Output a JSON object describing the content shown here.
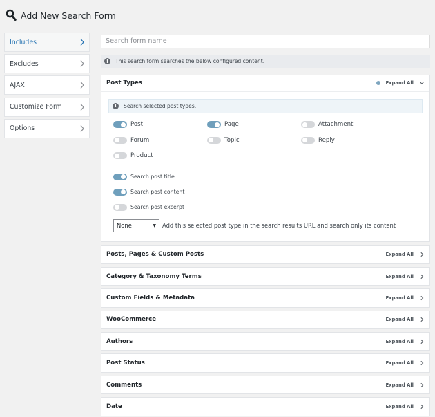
{
  "page": {
    "title": "Add New Search Form"
  },
  "sidebar": {
    "items": [
      {
        "label": "Includes",
        "active": true
      },
      {
        "label": "Excludes",
        "active": false
      },
      {
        "label": "AJAX",
        "active": false
      },
      {
        "label": "Customize Form",
        "active": false
      },
      {
        "label": "Options",
        "active": false
      }
    ]
  },
  "form": {
    "name_placeholder": "Search form name",
    "notice": "This search form searches the below configured content."
  },
  "post_types": {
    "title": "Post Types",
    "expand_label": "Expand All",
    "info": "Search selected post types.",
    "types": [
      {
        "label": "Post",
        "on": true
      },
      {
        "label": "Page",
        "on": true
      },
      {
        "label": "Attachment",
        "on": false
      },
      {
        "label": "Forum",
        "on": false
      },
      {
        "label": "Topic",
        "on": false
      },
      {
        "label": "Reply",
        "on": false
      },
      {
        "label": "Product",
        "on": false
      }
    ],
    "options": [
      {
        "label": "Search post title",
        "on": true
      },
      {
        "label": "Search post content",
        "on": true
      },
      {
        "label": "Search post excerpt",
        "on": false
      }
    ],
    "select_value": "None",
    "select_description": "Add this selected post type in the search results URL and search only its content"
  },
  "sections": [
    {
      "title": "Posts, Pages & Custom Posts",
      "expand_label": "Expand All"
    },
    {
      "title": "Category & Taxonomy Terms",
      "expand_label": "Expand All"
    },
    {
      "title": "Custom Fields & Metadata",
      "expand_label": "Expand All"
    },
    {
      "title": "WooCommerce",
      "expand_label": "Expand All"
    },
    {
      "title": "Authors",
      "expand_label": "Expand All"
    },
    {
      "title": "Post Status",
      "expand_label": "Expand All"
    },
    {
      "title": "Comments",
      "expand_label": "Expand All"
    },
    {
      "title": "Date",
      "expand_label": "Expand All"
    }
  ],
  "colors": {
    "toggle_on": "#6f9fbc",
    "toggle_off": "#d5d7da",
    "active_nav": "#2271b1"
  },
  "icons": {
    "title": "search-icon",
    "nav": "chevron-right-icon",
    "info": "info-icon"
  }
}
